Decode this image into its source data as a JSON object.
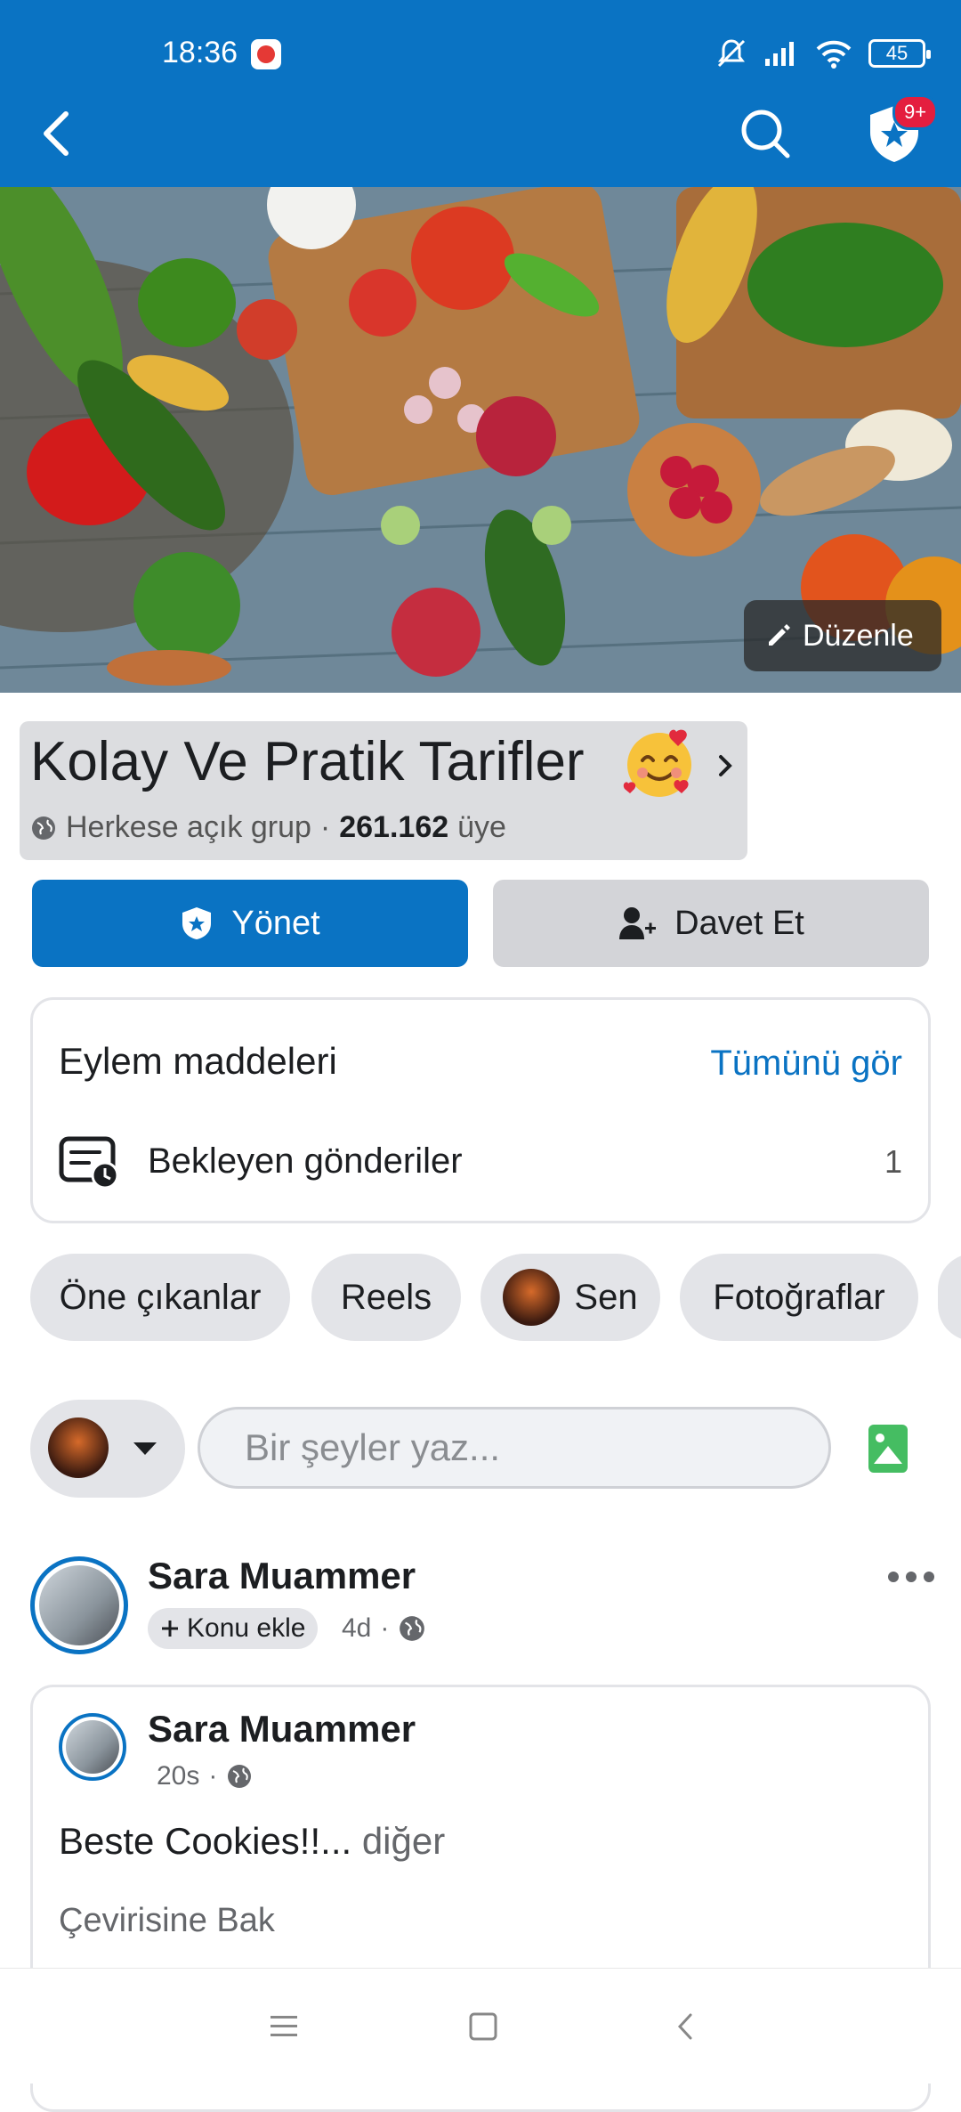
{
  "status_bar": {
    "time": "18:36",
    "battery": "45"
  },
  "header": {
    "notification_badge": "9+"
  },
  "cover": {
    "edit_label": "Düzenle"
  },
  "group": {
    "name": "Kolay Ve Pratik Tarifler",
    "privacy": "Herkese açık grup",
    "separator": "·",
    "member_count": "261.162",
    "member_unit": "üye"
  },
  "actions": {
    "manage_label": "Yönet",
    "invite_label": "Davet Et"
  },
  "action_items": {
    "title": "Eylem maddeleri",
    "see_all": "Tümünü gör",
    "pending_label": "Bekleyen gönderiler",
    "pending_count": "1"
  },
  "chips": [
    "Öne çıkanlar",
    "Reels",
    "Sen",
    "Fotoğraflar"
  ],
  "composer": {
    "placeholder": "Bir şeyler yaz..."
  },
  "post": {
    "author": "Sara Muammer",
    "topic_label": "Konu ekle",
    "time": "4d",
    "separator": "·",
    "shared": {
      "author": "Sara Muammer",
      "time": "20s",
      "separator": "·",
      "text": "Beste Cookies!!...",
      "more": "diğer",
      "translate": "Çevirisine Bak"
    }
  },
  "colors": {
    "brand": "#0a73c3",
    "badge": "#e41e3f",
    "chip_bg": "#e3e4e8"
  }
}
